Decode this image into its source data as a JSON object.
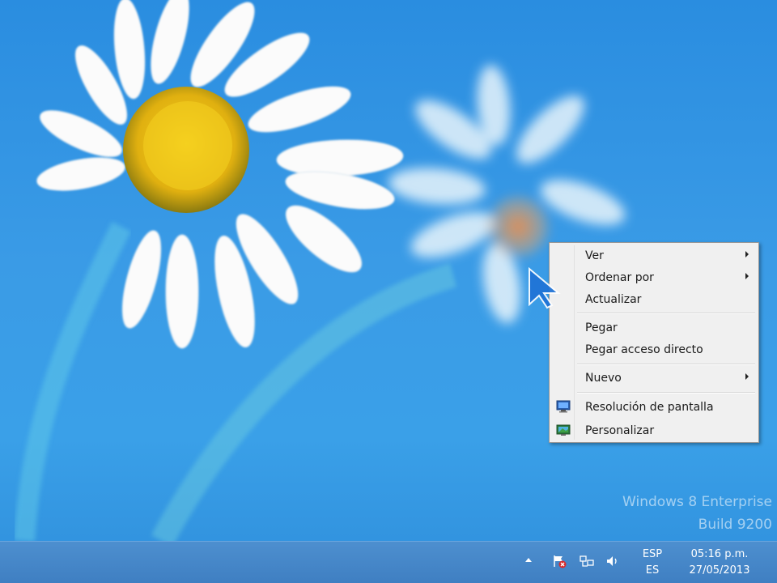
{
  "desktop": {
    "watermark_line1": "Windows 8 Enterprise",
    "watermark_line2": "Build 9200"
  },
  "context_menu": {
    "items": [
      {
        "label": "Ver",
        "submenu": true
      },
      {
        "label": "Ordenar por",
        "submenu": true
      },
      {
        "label": "Actualizar",
        "submenu": false
      },
      {
        "label": "Pegar",
        "submenu": false
      },
      {
        "label": "Pegar acceso directo",
        "submenu": false
      },
      {
        "label": "Nuevo",
        "submenu": true
      },
      {
        "label": "Resolución de pantalla",
        "submenu": false,
        "icon": "display-icon"
      },
      {
        "label": "Personalizar",
        "submenu": false,
        "icon": "personalize-icon"
      }
    ]
  },
  "taskbar": {
    "language_top": "ESP",
    "language_bottom": "ES",
    "time": "05:16 p.m.",
    "date": "27/05/2013",
    "tray_icons": [
      "show-hidden-icons",
      "action-center-icon",
      "network-icon",
      "volume-icon"
    ]
  },
  "colors": {
    "desktop_blue": "#3a9be6",
    "taskbar": "#4587c8",
    "menu_bg": "#f0f0f0"
  }
}
